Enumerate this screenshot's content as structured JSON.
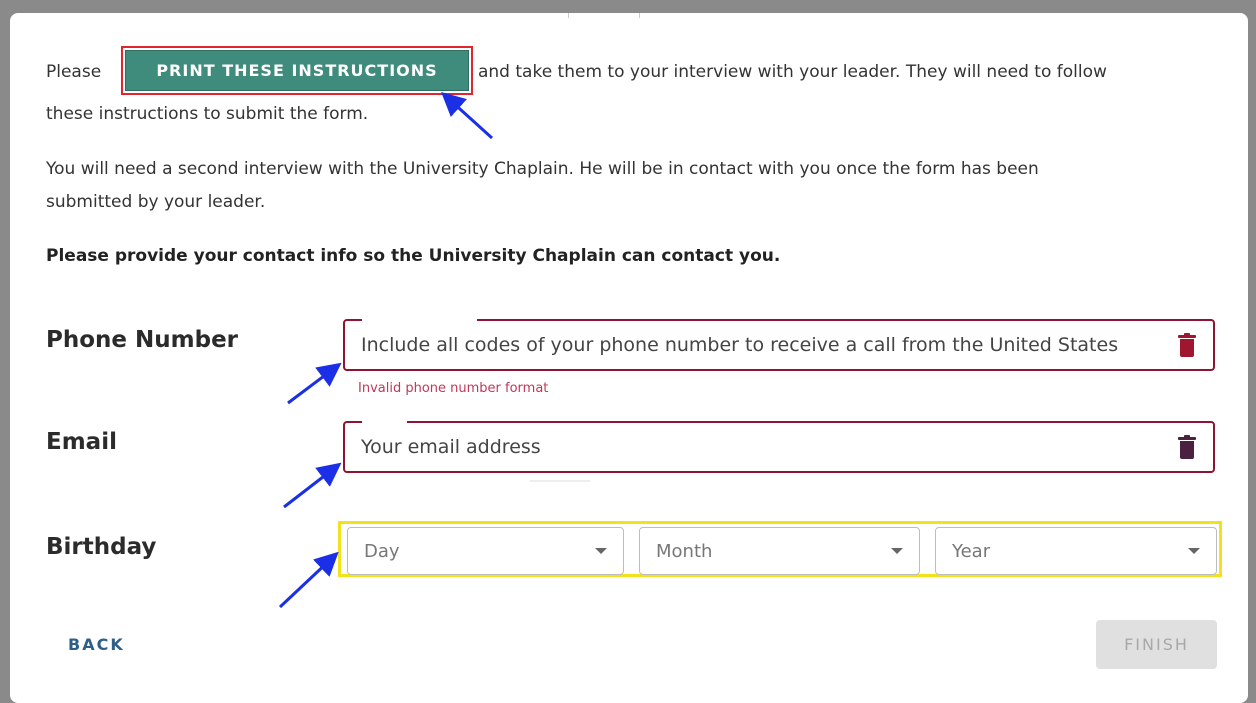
{
  "intro": {
    "please": "Please",
    "print_button": "PRINT THESE INSTRUCTIONS",
    "line1_rest": "and take them to your interview with your leader. They will need to follow",
    "line2": "these instructions to submit the form.",
    "line3": "You will need a second interview with the University Chaplain. He will be in contact with you once the form has been",
    "line4": "submitted by your leader.",
    "contact_prompt": "Please provide your contact info so the University Chaplain can contact you."
  },
  "phone": {
    "label": "Phone Number",
    "value": "Include all codes of your phone number to receive a call from the United States",
    "error": "Invalid phone number format"
  },
  "email": {
    "label": "Email",
    "value": "Your email address"
  },
  "birthday": {
    "label": "Birthday",
    "day": "Day",
    "month": "Month",
    "year": "Year"
  },
  "actions": {
    "back": "BACK",
    "finish": "FINISH"
  },
  "colors": {
    "print_button_bg": "#3f8b7c",
    "field_border": "#8f1434",
    "error_text": "#c2385a",
    "highlight_red": "#e0252f",
    "highlight_yellow": "#f3e21a",
    "annotation_arrow": "#1a2fe6"
  }
}
